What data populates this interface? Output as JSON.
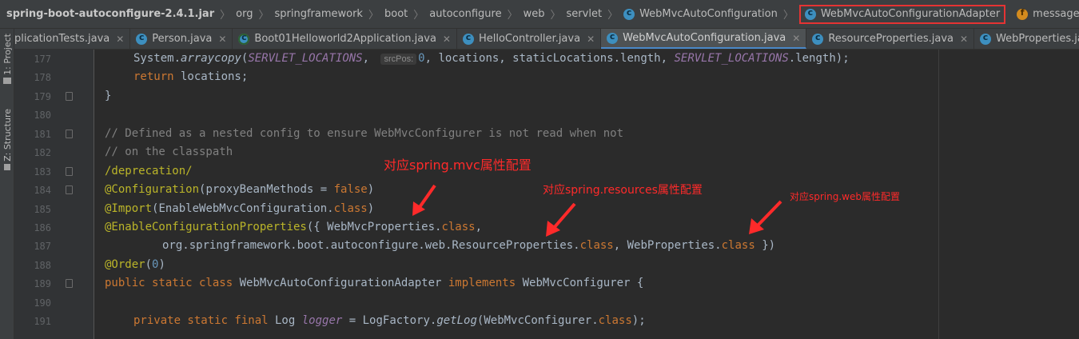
{
  "breadcrumb": [
    {
      "label": "spring-boot-autoconfigure-2.4.1.jar",
      "icon": "",
      "root": true
    },
    {
      "label": "org",
      "icon": ""
    },
    {
      "label": "springframework",
      "icon": ""
    },
    {
      "label": "boot",
      "icon": ""
    },
    {
      "label": "autoconfigure",
      "icon": ""
    },
    {
      "label": "web",
      "icon": ""
    },
    {
      "label": "servlet",
      "icon": ""
    },
    {
      "label": "WebMvcAutoConfiguration",
      "icon": "class-icon"
    },
    {
      "label": "WebMvcAutoConfigurationAdapter",
      "icon": "class-icon",
      "highlighted": true
    },
    {
      "label": "messageConvertersProvider",
      "icon": "field-icon"
    }
  ],
  "tabs": [
    {
      "label": "plicationTests.java",
      "icon": ""
    },
    {
      "label": "Person.java",
      "icon": "class-icon"
    },
    {
      "label": "Boot01Helloworld2Application.java",
      "icon": "spring-class-icon"
    },
    {
      "label": "HelloController.java",
      "icon": "class-icon"
    },
    {
      "label": "WebMvcAutoConfiguration.java",
      "icon": "class-icon",
      "active": true
    },
    {
      "label": "ResourceProperties.java",
      "icon": "class-icon"
    },
    {
      "label": "WebProperties.java",
      "icon": "class-icon"
    }
  ],
  "tool_windows": {
    "project": "1: Project",
    "structure": "Z: Structure"
  },
  "line_numbers": [
    "177",
    "178",
    "179",
    "180",
    "181",
    "182",
    "183",
    "184",
    "185",
    "186",
    "187",
    "188",
    "189",
    "190",
    "191"
  ],
  "code": {
    "l177": {
      "a": "System.",
      "b": "arraycopy",
      "c": "(",
      "d": "SERVLET_LOCATIONS",
      "e": ", ",
      "hint": "srcPos:",
      "f": "0",
      "g": ", locations, staticLocations.length, ",
      "h": "SERVLET_LOCATIONS",
      "i": ".length);"
    },
    "l178": {
      "kw": "return",
      "rest": " locations;"
    },
    "l179": {
      "text": "}"
    },
    "l181": {
      "text": "// Defined as a nested config to ensure WebMvcConfigurer is not read when not"
    },
    "l182": {
      "text": "// on the classpath"
    },
    "l183": {
      "text": "/deprecation/"
    },
    "l184": {
      "an": "@Configuration",
      "a": "(proxyBeanMethods = ",
      "kw": "false",
      "b": ")"
    },
    "l185": {
      "an": "@Import",
      "a": "(EnableWebMvcConfiguration.",
      "kw": "class",
      "b": ")"
    },
    "l186": {
      "an": "@EnableConfigurationProperties",
      "a": "({ WebMvcProperties.",
      "kw": "class",
      "b": ","
    },
    "l187": {
      "a": "org.springframework.boot.autoconfigure.web.ResourceProperties.",
      "kw1": "class",
      "b": ", WebProperties.",
      "kw2": "class",
      "c": " })"
    },
    "l188": {
      "an": "@Order",
      "a": "(",
      "num": "0",
      "b": ")"
    },
    "l189": {
      "kw1": "public static class",
      "a": " WebMvcAutoConfigurationAdapter ",
      "kw2": "implements",
      "b": " WebMvcConfigurer {"
    },
    "l191": {
      "kw": "private static final",
      "a": " Log ",
      "fld": "logger",
      "b": " = LogFactory.",
      "m": "getLog",
      "c": "(WebMvcConfigurer.",
      "kw2": "class",
      "d": ");"
    }
  },
  "annotations": {
    "mvc": "对应spring.mvc属性配置",
    "resources": "对应spring.resources属性配置",
    "web": "对应spring.web属性配置"
  },
  "colors": {
    "annotation": "#ff2a2a",
    "highlight_box": "#e53333",
    "editor_bg": "#2b2b2b"
  }
}
